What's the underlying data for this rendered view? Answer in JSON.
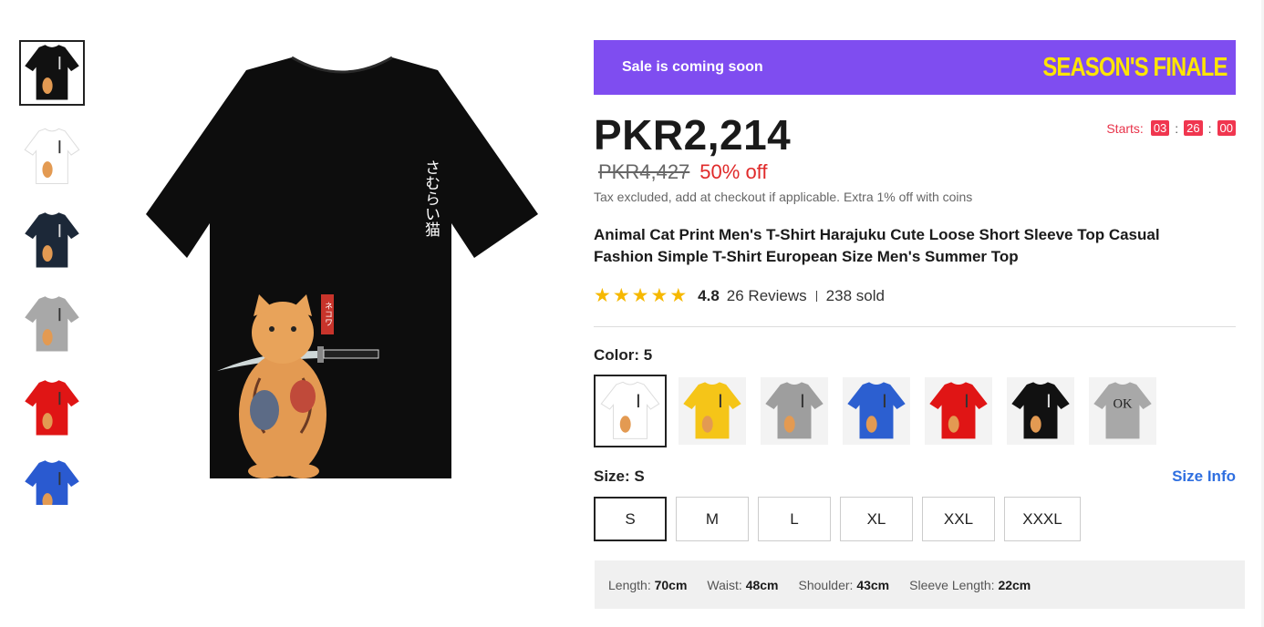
{
  "thumbnails": [
    {
      "color": "#111111",
      "active": true
    },
    {
      "color": "#ffffff",
      "active": false
    },
    {
      "color": "#1c2838",
      "active": false
    },
    {
      "color": "#a8a8a8",
      "active": false
    },
    {
      "color": "#e01515",
      "active": false
    },
    {
      "color": "#2a5ad0",
      "active": false
    }
  ],
  "main_image": {
    "shirt_color": "#0d0d0d",
    "vertical_text": "さむらい猫",
    "tag_text": "ネコワ"
  },
  "banner": {
    "left": "Sale is coming soon",
    "right": "SEASON'S FINALE",
    "bg": "#7f4df0",
    "accent": "#ffe500"
  },
  "price": {
    "current": "PKR2,214",
    "original": "PKR4,427",
    "discount": "50% off",
    "tax_note": "Tax excluded, add at checkout if applicable. Extra 1% off with coins"
  },
  "countdown": {
    "label": "Starts:",
    "hours": "03",
    "minutes": "26",
    "seconds": "00",
    "sep": ":"
  },
  "product_title": "Animal Cat Print Men's T-Shirt Harajuku Cute Loose Short Sleeve Top Casual Fashion Simple T-Shirt European Size Men's Summer Top",
  "rating": {
    "stars": 5,
    "value": "4.8",
    "reviews": "26 Reviews",
    "sold": "238 sold"
  },
  "color": {
    "label": "Color: 5",
    "options": [
      {
        "color": "#ffffff",
        "print": "cat",
        "active": true
      },
      {
        "color": "#f5c518",
        "print": "cat",
        "active": false
      },
      {
        "color": "#9e9e9e",
        "print": "cat",
        "active": false
      },
      {
        "color": "#2c5fd0",
        "print": "cat",
        "active": false
      },
      {
        "color": "#e01515",
        "print": "cat",
        "active": false
      },
      {
        "color": "#111111",
        "print": "cat",
        "active": false
      },
      {
        "color": "#a8a8a8",
        "print": "OK",
        "active": false
      }
    ]
  },
  "size": {
    "label": "Size: S",
    "info_link": "Size Info",
    "options": [
      "S",
      "M",
      "L",
      "XL",
      "XXL",
      "XXXL"
    ],
    "selected": "S"
  },
  "measurements": [
    {
      "label": "Length:",
      "value": "70cm"
    },
    {
      "label": "Waist:",
      "value": "48cm"
    },
    {
      "label": "Shoulder:",
      "value": "43cm"
    },
    {
      "label": "Sleeve Length:",
      "value": "22cm"
    }
  ]
}
